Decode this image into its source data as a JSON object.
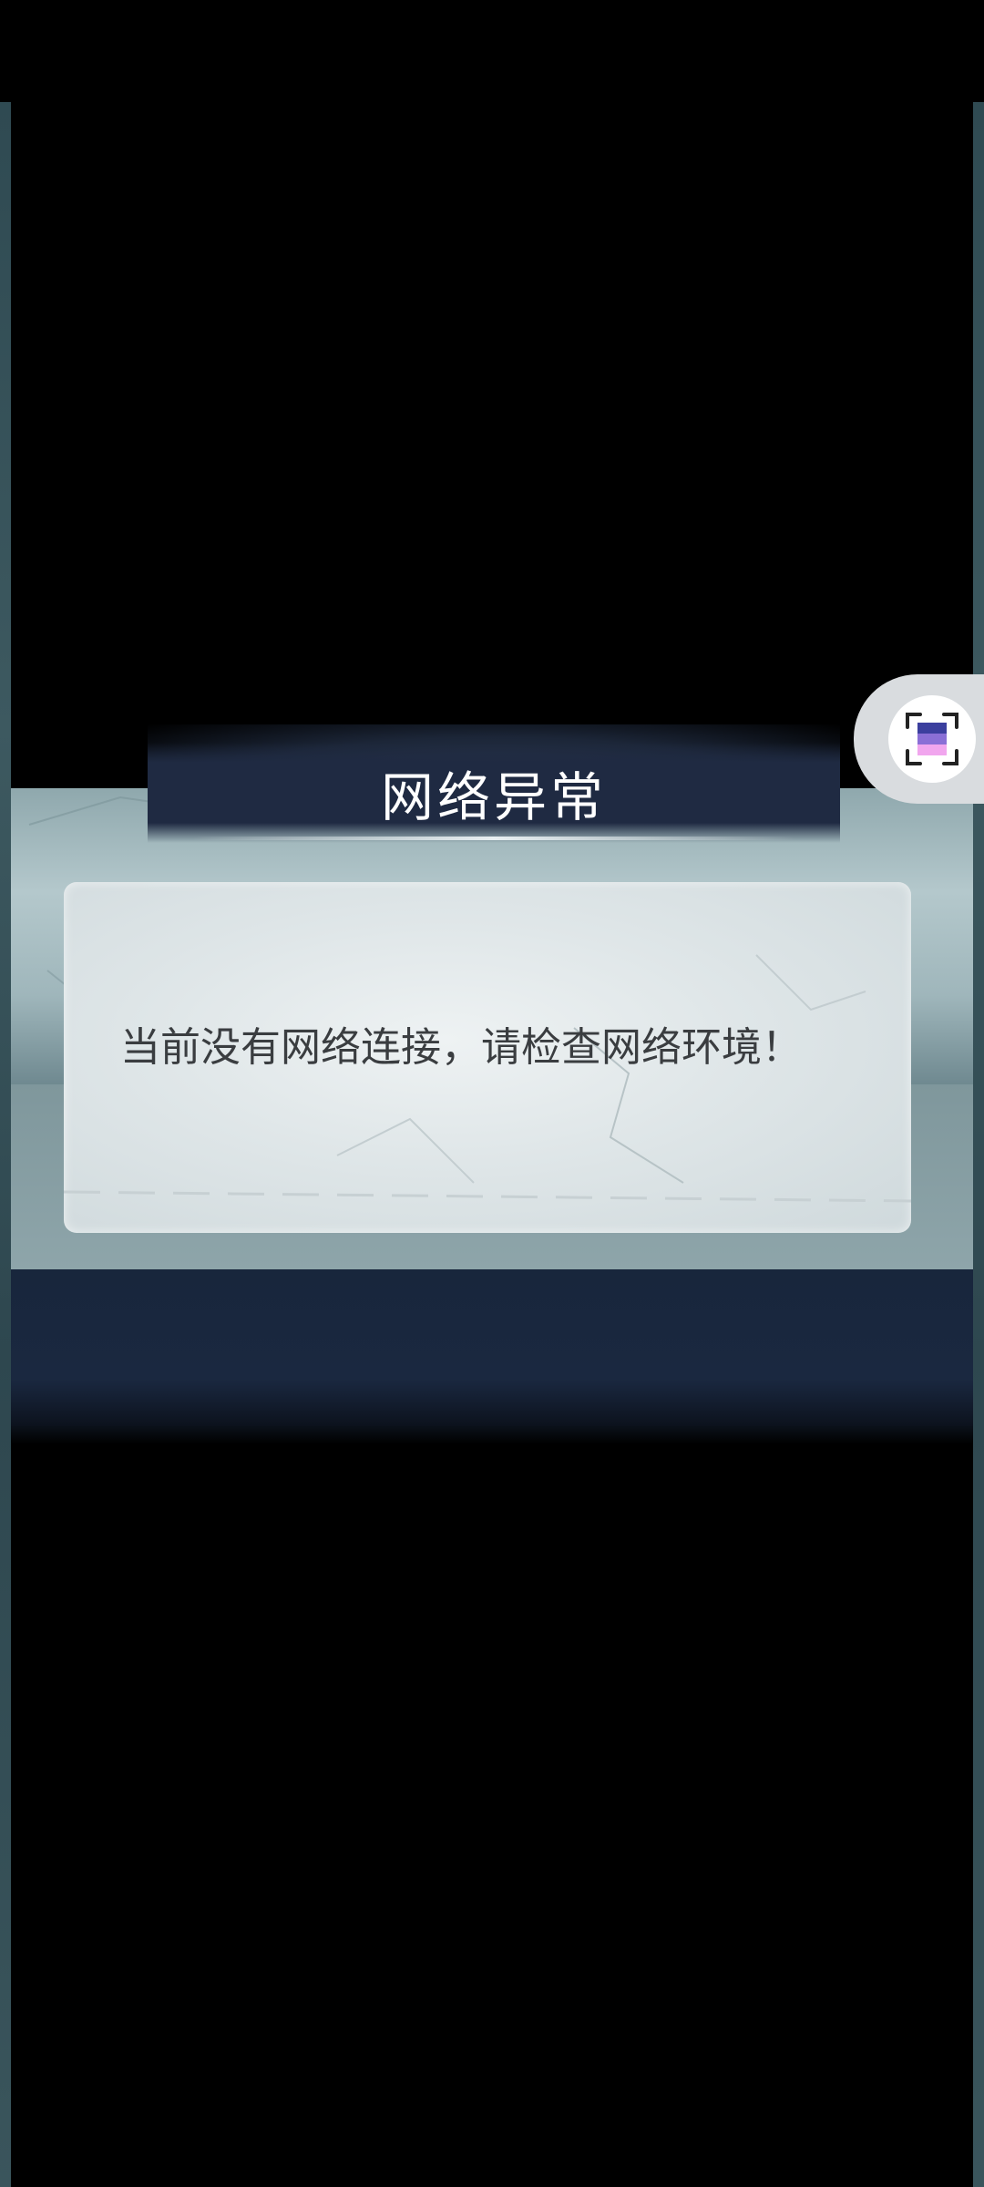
{
  "dialog": {
    "title": "网络异常",
    "message": "当前没有网络连接，请检查网络环境！"
  },
  "floating_button": {
    "icon": "screenshot-capture-icon"
  },
  "colors": {
    "background": "#000000",
    "header_band": "#1f2a42",
    "footer_band": "#1a2840",
    "panel": "#dfe6e8",
    "message_text": "#3a3d40",
    "title_text": "#ffffff"
  }
}
